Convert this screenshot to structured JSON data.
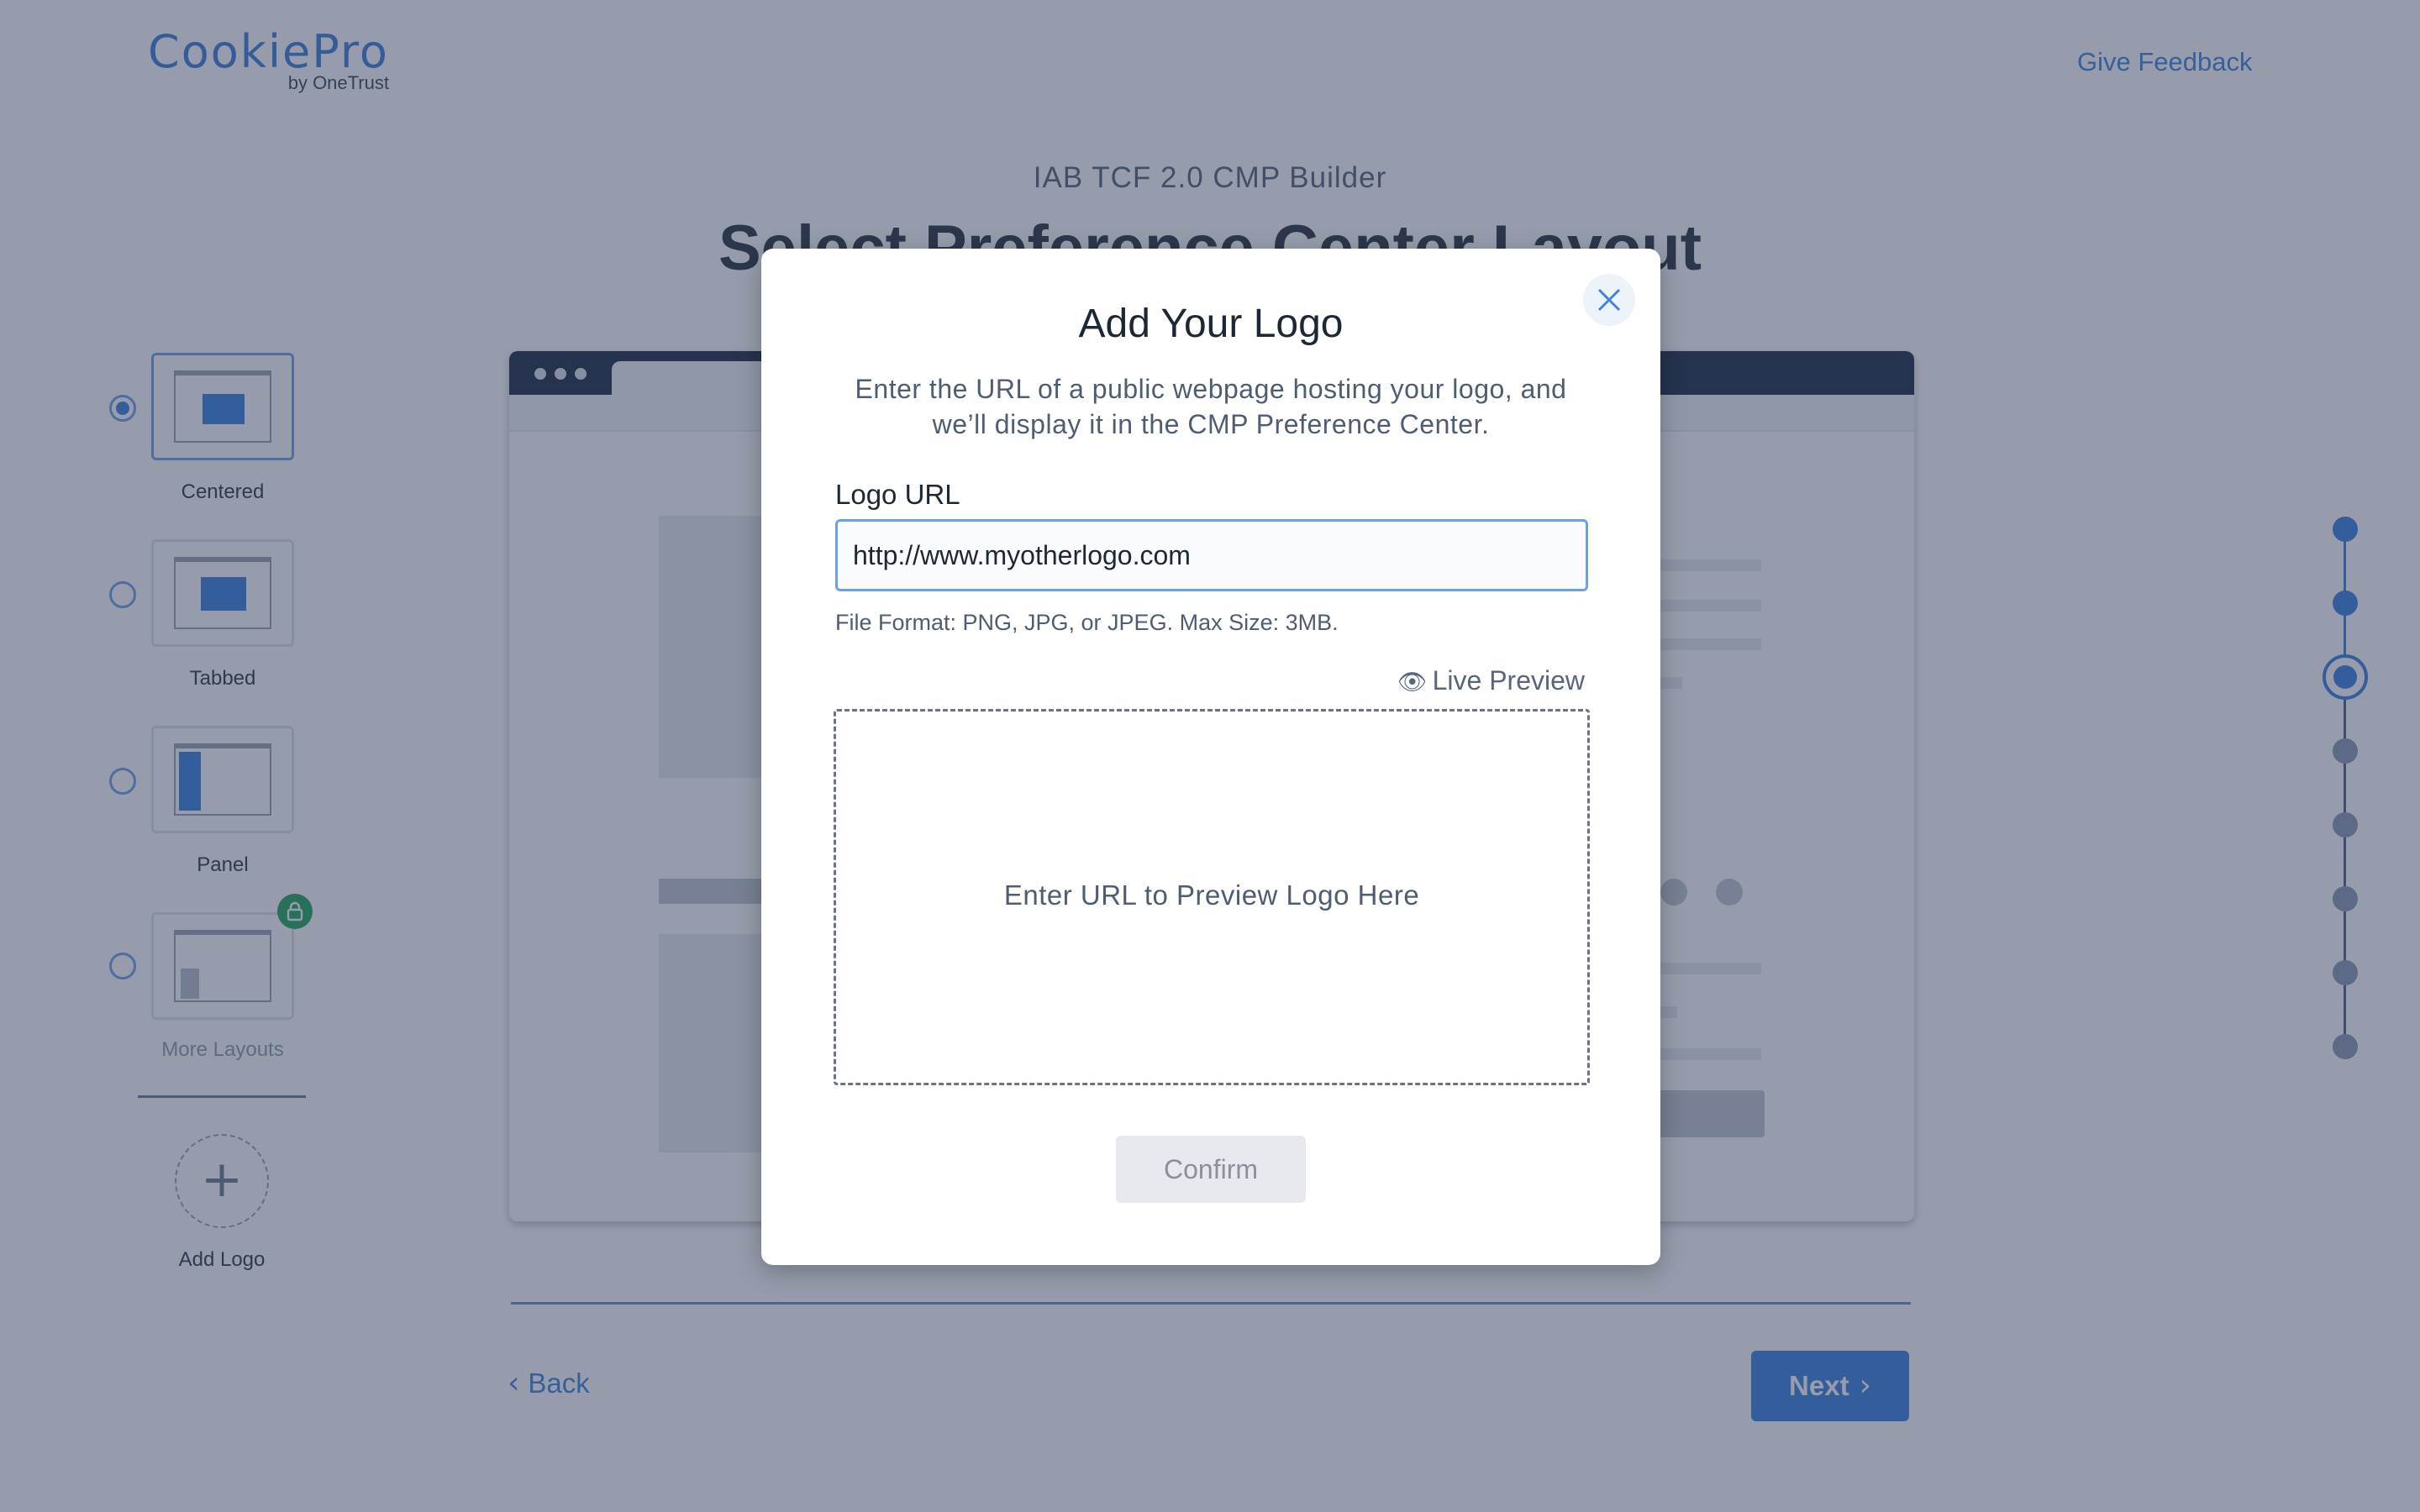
{
  "header": {
    "brand": "CookiePro",
    "brand_sub": "by OneTrust",
    "feedback_link": "Give Feedback"
  },
  "page": {
    "subtitle": "IAB TCF 2.0 CMP Builder",
    "title": "Select Preference Center Layout"
  },
  "layouts": {
    "selected": "Centered",
    "items": [
      {
        "label": "Centered"
      },
      {
        "label": "Tabbed"
      },
      {
        "label": "Panel"
      },
      {
        "label": "More Layouts"
      }
    ],
    "add_logo": "Add Logo"
  },
  "nav": {
    "back": "Back",
    "next": "Next"
  },
  "stepper": {
    "total_steps": 8,
    "current_step": 3
  },
  "modal": {
    "title": "Add Your Logo",
    "description": "Enter the URL of a public webpage hosting your logo, and we’ll display it in the CMP Preference Center.",
    "field_label": "Logo URL",
    "url_value": "http://www.myotherlogo.com",
    "help_text": "File Format: PNG, JPG, or JPEG. Max Size: 3MB.",
    "live_preview": "Live Preview",
    "preview_placeholder": "Enter URL to Preview Logo Here",
    "confirm": "Confirm"
  },
  "colors": {
    "accent": "#3b82df",
    "overlay": "#2e3a58",
    "lock_badge": "#25a65e"
  },
  "icons": {
    "close": "close-icon",
    "eye": "eye-icon",
    "lock": "lock-icon",
    "plus": "plus-icon",
    "back": "chevron-left-icon",
    "next": "chevron-right-icon"
  }
}
